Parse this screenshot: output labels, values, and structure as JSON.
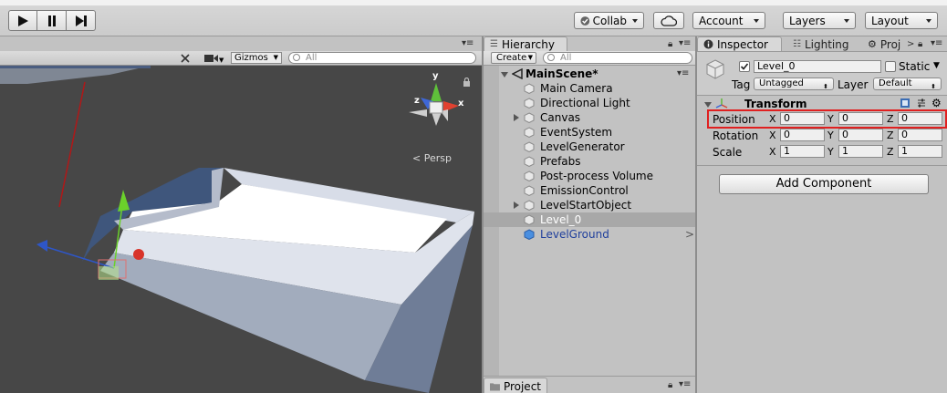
{
  "toolbar": {
    "collab_label": "Collab",
    "account_label": "Account",
    "layers_label": "Layers",
    "layout_label": "Layout"
  },
  "scene": {
    "gizmos_label": "Gizmos",
    "search_placeholder": "All",
    "projection_label": "Persp",
    "axis_y": "y",
    "axis_x": "x",
    "axis_z": "z"
  },
  "hierarchy": {
    "tab_label": "Hierarchy",
    "create_label": "Create",
    "search_placeholder": "All",
    "scene_name": "MainScene*",
    "items": [
      {
        "label": "Main Camera"
      },
      {
        "label": "Directional Light"
      },
      {
        "label": "Canvas"
      },
      {
        "label": "EventSystem"
      },
      {
        "label": "LevelGenerator"
      },
      {
        "label": "Prefabs"
      },
      {
        "label": "Post-process Volume"
      },
      {
        "label": "EmissionControl"
      },
      {
        "label": "LevelStartObject"
      },
      {
        "label": "Level_0"
      },
      {
        "label": "LevelGround"
      }
    ],
    "selected_color": "#a8a8a8",
    "prefab_color": "#1f3f9c"
  },
  "project": {
    "tab_label": "Project"
  },
  "inspector": {
    "tabs": {
      "inspector": "Inspector",
      "lighting": "Lighting",
      "project": "Proj"
    },
    "object_name": "Level_0",
    "static_label": "Static",
    "tag_label": "Tag",
    "tag_value": "Untagged",
    "layer_label": "Layer",
    "layer_value": "Default",
    "transform_title": "Transform",
    "rows": [
      {
        "label": "Position",
        "x": "0",
        "y": "0",
        "z": "0"
      },
      {
        "label": "Rotation",
        "x": "0",
        "y": "0",
        "z": "0"
      },
      {
        "label": "Scale",
        "x": "1",
        "y": "1",
        "z": "1"
      }
    ],
    "axis_labels": {
      "x": "X",
      "y": "Y",
      "z": "Z"
    },
    "add_component_label": "Add Component",
    "highlight_color": "#e02020"
  }
}
